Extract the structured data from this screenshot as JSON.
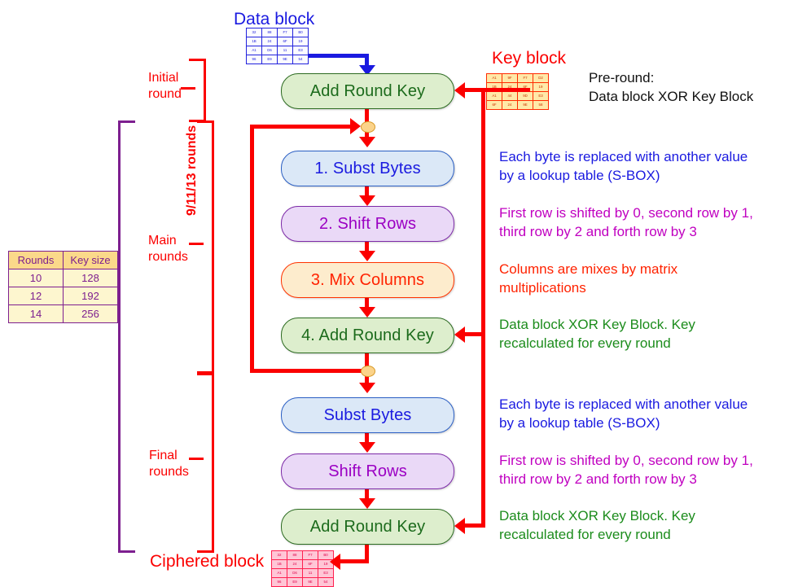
{
  "titles": {
    "data_block": "Data block",
    "key_block": "Key block",
    "ciphered_block": "Ciphered block"
  },
  "byte_grids": {
    "data_block": [
      [
        "32",
        "88",
        "F7",
        "B0"
      ],
      [
        "1B",
        "24",
        "6F",
        "19"
      ],
      [
        "A1",
        "D6",
        "11",
        "E3"
      ],
      [
        "96",
        "E9",
        "9E",
        "54"
      ]
    ],
    "key_block": [
      [
        "A1",
        "9F",
        "F7",
        "D2"
      ],
      [
        "1B",
        "24",
        "6F",
        "19"
      ],
      [
        "A1",
        "44",
        "9D",
        "E3"
      ],
      [
        "6F",
        "24",
        "9E",
        "58"
      ]
    ],
    "ciphered_block": [
      [
        "32",
        "88",
        "F7",
        "B0"
      ],
      [
        "1B",
        "24",
        "6F",
        "19"
      ],
      [
        "A1",
        "D6",
        "11",
        "E3"
      ],
      [
        "96",
        "E9",
        "9E",
        "54"
      ]
    ]
  },
  "boxes": {
    "initial_add_round_key": "Add Round Key",
    "subst_bytes_1": "1. Subst Bytes",
    "shift_rows_2": "2. Shift Rows",
    "mix_columns_3": "3. Mix Columns",
    "add_round_key_4": "4. Add Round Key",
    "subst_bytes_final": "Subst Bytes",
    "shift_rows_final": "Shift Rows",
    "add_round_key_final": "Add Round Key"
  },
  "brackets": {
    "initial_round": "Initial\nround",
    "initial_round_line1": "Initial",
    "initial_round_line2": "round",
    "main_rounds_line1": "Main",
    "main_rounds_line2": "rounds",
    "final_rounds_line1": "Final",
    "final_rounds_line2": "rounds",
    "loop_rounds": "9/11/13 rounds"
  },
  "rounds_table": {
    "headers": [
      "Rounds",
      "Key size"
    ],
    "rows": [
      [
        "10",
        "128"
      ],
      [
        "12",
        "192"
      ],
      [
        "14",
        "256"
      ]
    ]
  },
  "notes": {
    "pre_round_line1": "Pre-round:",
    "pre_round_line2": "Data block XOR Key Block",
    "subst_line1": "Each byte is replaced with another value",
    "subst_line2": "by a lookup table (S-BOX)",
    "shift_line1": "First row is shifted by 0, second row by 1,",
    "shift_line2": "third row by 2 and forth row by 3",
    "mix_line1": "Columns are mixes by matrix",
    "mix_line2": "multiplications",
    "ark_line1": "Data block XOR Key Block. Key",
    "ark_line2": "recalculated for every round",
    "subst_final_line1": "Each byte is replaced with another value",
    "subst_final_line2": "by a lookup table (S-BOX)",
    "shift_final_line1": "First row is shifted by 0, second row by 1,",
    "shift_final_line2": "third row by 2 and forth row by 3",
    "ark_final_line1": "Data block XOR Key Block. Key",
    "ark_final_line2": "recalculated for every round"
  },
  "colors": {
    "flow_red": "#fb0000",
    "data_blue": "#1a1ae0",
    "key_red": "#fb0000",
    "purple_bracket": "#7d1f8f",
    "green_box": "#1c6b1c",
    "node_fill": "#fbd38a"
  }
}
